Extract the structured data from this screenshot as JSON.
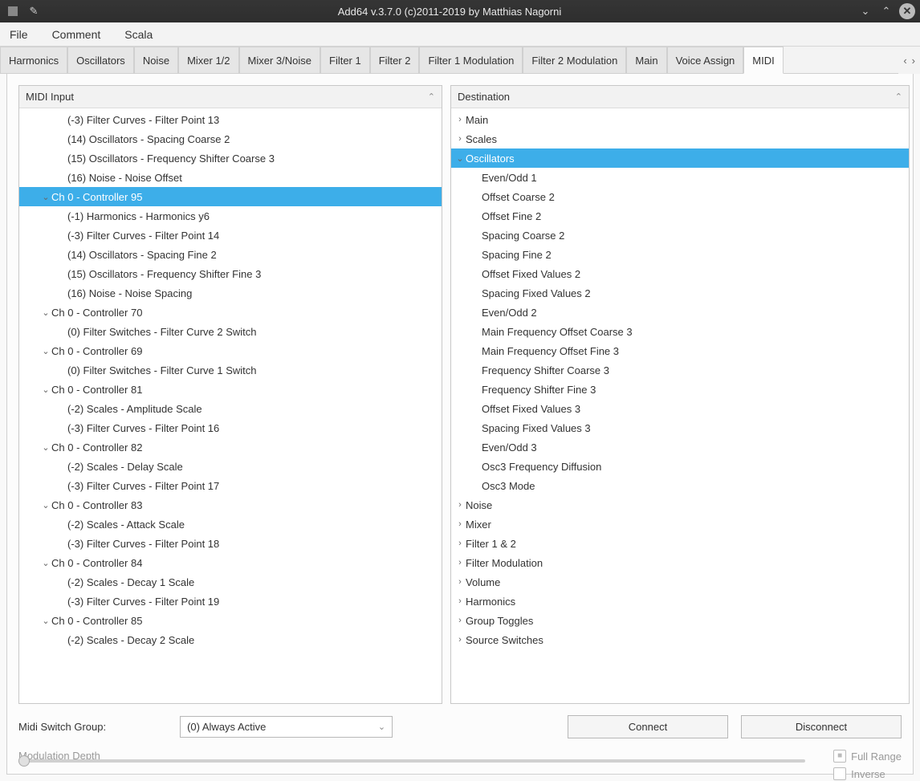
{
  "window": {
    "title": "Add64  v.3.7.0   (c)2011-2019 by Matthias Nagorni"
  },
  "menu": [
    "File",
    "Comment",
    "Scala"
  ],
  "tabs": [
    "Harmonics",
    "Oscillators",
    "Noise",
    "Mixer 1/2",
    "Mixer 3/Noise",
    "Filter 1",
    "Filter 2",
    "Filter 1 Modulation",
    "Filter 2 Modulation",
    "Main",
    "Voice Assign",
    "MIDI"
  ],
  "active_tab": "MIDI",
  "midi_input": {
    "header": "MIDI Input",
    "rows": [
      {
        "indent": 2,
        "exp": "",
        "text": "(-3) Filter Curves - Filter Point 13"
      },
      {
        "indent": 2,
        "exp": "",
        "text": "(14) Oscillators - Spacing Coarse 2"
      },
      {
        "indent": 2,
        "exp": "",
        "text": "(15) Oscillators - Frequency Shifter Coarse 3"
      },
      {
        "indent": 2,
        "exp": "",
        "text": "(16) Noise - Noise Offset"
      },
      {
        "indent": 1,
        "exp": "v",
        "text": "Ch 0 - Controller 95",
        "selected": true
      },
      {
        "indent": 2,
        "exp": "",
        "text": "(-1) Harmonics - Harmonics y6"
      },
      {
        "indent": 2,
        "exp": "",
        "text": "(-3) Filter Curves - Filter Point 14"
      },
      {
        "indent": 2,
        "exp": "",
        "text": "(14) Oscillators - Spacing Fine 2"
      },
      {
        "indent": 2,
        "exp": "",
        "text": "(15) Oscillators - Frequency Shifter Fine 3"
      },
      {
        "indent": 2,
        "exp": "",
        "text": "(16) Noise - Noise Spacing"
      },
      {
        "indent": 1,
        "exp": "v",
        "text": "Ch 0 - Controller 70"
      },
      {
        "indent": 2,
        "exp": "",
        "text": "(0) Filter Switches - Filter Curve 2  Switch"
      },
      {
        "indent": 1,
        "exp": "v",
        "text": "Ch 0 - Controller 69"
      },
      {
        "indent": 2,
        "exp": "",
        "text": "(0) Filter Switches - Filter Curve 1  Switch"
      },
      {
        "indent": 1,
        "exp": "v",
        "text": "Ch 0 - Controller 81"
      },
      {
        "indent": 2,
        "exp": "",
        "text": "(-2) Scales - Amplitude Scale"
      },
      {
        "indent": 2,
        "exp": "",
        "text": "(-3) Filter Curves - Filter Point 16"
      },
      {
        "indent": 1,
        "exp": "v",
        "text": "Ch 0 - Controller 82"
      },
      {
        "indent": 2,
        "exp": "",
        "text": "(-2) Scales - Delay Scale"
      },
      {
        "indent": 2,
        "exp": "",
        "text": "(-3) Filter Curves - Filter Point 17"
      },
      {
        "indent": 1,
        "exp": "v",
        "text": "Ch 0 - Controller 83"
      },
      {
        "indent": 2,
        "exp": "",
        "text": "(-2) Scales - Attack Scale"
      },
      {
        "indent": 2,
        "exp": "",
        "text": "(-3) Filter Curves - Filter Point 18"
      },
      {
        "indent": 1,
        "exp": "v",
        "text": "Ch 0 - Controller 84"
      },
      {
        "indent": 2,
        "exp": "",
        "text": "(-2) Scales - Decay 1 Scale"
      },
      {
        "indent": 2,
        "exp": "",
        "text": "(-3) Filter Curves - Filter Point 19"
      },
      {
        "indent": 1,
        "exp": "v",
        "text": "Ch 0 - Controller 85"
      },
      {
        "indent": 2,
        "exp": "",
        "text": "(-2) Scales - Decay 2 Scale"
      }
    ]
  },
  "destination": {
    "header": "Destination",
    "rows": [
      {
        "indent": 0,
        "exp": ">",
        "text": "Main"
      },
      {
        "indent": 0,
        "exp": ">",
        "text": "Scales"
      },
      {
        "indent": 0,
        "exp": "v",
        "text": "Oscillators",
        "selected": true
      },
      {
        "indent": 1,
        "exp": "",
        "text": "Even/Odd 1"
      },
      {
        "indent": 1,
        "exp": "",
        "text": "Offset Coarse 2"
      },
      {
        "indent": 1,
        "exp": "",
        "text": "Offset Fine 2"
      },
      {
        "indent": 1,
        "exp": "",
        "text": "Spacing Coarse 2"
      },
      {
        "indent": 1,
        "exp": "",
        "text": "Spacing Fine 2"
      },
      {
        "indent": 1,
        "exp": "",
        "text": "Offset Fixed Values 2"
      },
      {
        "indent": 1,
        "exp": "",
        "text": "Spacing Fixed Values 2"
      },
      {
        "indent": 1,
        "exp": "",
        "text": "Even/Odd 2"
      },
      {
        "indent": 1,
        "exp": "",
        "text": "Main Frequency Offset Coarse 3"
      },
      {
        "indent": 1,
        "exp": "",
        "text": "Main Frequency Offset Fine 3"
      },
      {
        "indent": 1,
        "exp": "",
        "text": "Frequency Shifter Coarse 3"
      },
      {
        "indent": 1,
        "exp": "",
        "text": "Frequency Shifter Fine 3"
      },
      {
        "indent": 1,
        "exp": "",
        "text": "Offset Fixed Values 3"
      },
      {
        "indent": 1,
        "exp": "",
        "text": "Spacing Fixed Values 3"
      },
      {
        "indent": 1,
        "exp": "",
        "text": "Even/Odd 3"
      },
      {
        "indent": 1,
        "exp": "",
        "text": "Osc3 Frequency Diffusion"
      },
      {
        "indent": 1,
        "exp": "",
        "text": "Osc3 Mode"
      },
      {
        "indent": 0,
        "exp": ">",
        "text": "Noise"
      },
      {
        "indent": 0,
        "exp": ">",
        "text": "Mixer"
      },
      {
        "indent": 0,
        "exp": ">",
        "text": "Filter 1 & 2"
      },
      {
        "indent": 0,
        "exp": ">",
        "text": "Filter Modulation"
      },
      {
        "indent": 0,
        "exp": ">",
        "text": "Volume"
      },
      {
        "indent": 0,
        "exp": ">",
        "text": "Harmonics"
      },
      {
        "indent": 0,
        "exp": ">",
        "text": "Group Toggles"
      },
      {
        "indent": 0,
        "exp": ">",
        "text": "Source Switches"
      }
    ]
  },
  "controls": {
    "midi_switch_group_label": "Midi Switch Group:",
    "midi_switch_group_value": "(0) Always Active",
    "connect": "Connect",
    "disconnect": "Disconnect",
    "modulation_depth": "Modulation Depth",
    "full_range": "Full Range",
    "inverse": "Inverse"
  }
}
